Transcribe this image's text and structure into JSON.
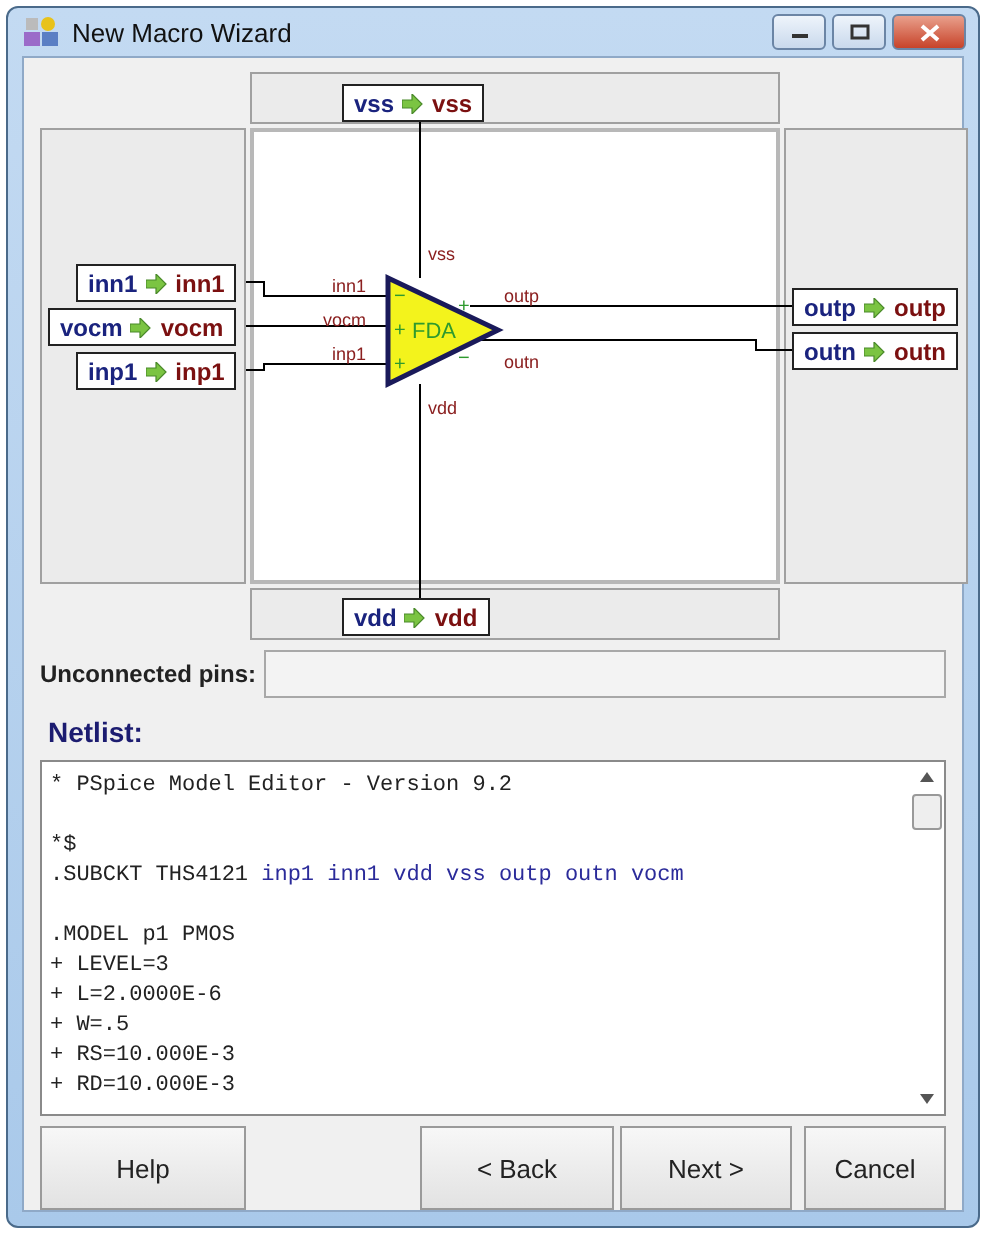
{
  "window": {
    "title": "New Macro Wizard"
  },
  "diagram": {
    "ports": {
      "top": [
        {
          "inner": "vss",
          "outer": "vss"
        }
      ],
      "left": [
        {
          "inner": "inn1",
          "outer": "inn1"
        },
        {
          "inner": "vocm",
          "outer": "vocm"
        },
        {
          "inner": "inp1",
          "outer": "inp1"
        }
      ],
      "right": [
        {
          "inner": "outp",
          "outer": "outp"
        },
        {
          "inner": "outn",
          "outer": "outn"
        }
      ],
      "bottom": [
        {
          "inner": "vdd",
          "outer": "vdd"
        }
      ]
    },
    "symbol": {
      "label": "FDA",
      "pins": {
        "top": "vss",
        "left": [
          "inn1",
          "vocm",
          "inp1"
        ],
        "right": [
          "outp",
          "outn"
        ],
        "bottom": "vdd"
      },
      "signs": {
        "in": [
          "−",
          "+",
          "+"
        ],
        "out": [
          "+",
          "−"
        ]
      }
    }
  },
  "unconnected": {
    "label": "Unconnected pins:"
  },
  "netlist": {
    "label": "Netlist:",
    "lines": [
      {
        "kind": "text",
        "text": "* PSpice Model Editor - Version 9.2"
      },
      {
        "kind": "blank"
      },
      {
        "kind": "text",
        "text": "*$"
      },
      {
        "kind": "subckt",
        "text": ".SUBCKT THS4121",
        "nodes": "inp1 inn1 vdd vss outp outn vocm"
      },
      {
        "kind": "blank"
      },
      {
        "kind": "text",
        "text": ".MODEL p1 PMOS"
      },
      {
        "kind": "text",
        "text": "+ LEVEL=3"
      },
      {
        "kind": "text",
        "text": "+ L=2.0000E-6"
      },
      {
        "kind": "text",
        "text": "+ W=.5"
      },
      {
        "kind": "text",
        "text": "+ RS=10.000E-3"
      },
      {
        "kind": "text",
        "text": "+ RD=10.000E-3"
      }
    ]
  },
  "buttons": {
    "help": "Help",
    "back": "< Back",
    "next": "Next >",
    "cancel": "Cancel"
  }
}
